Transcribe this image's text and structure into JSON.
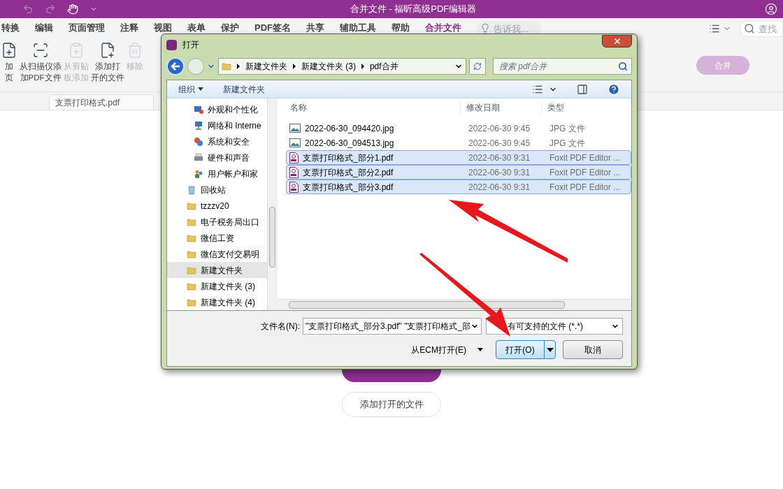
{
  "window": {
    "title": "合并文件 - 福昕高级PDF编辑器"
  },
  "menu": [
    {
      "label": "转换",
      "selected": false
    },
    {
      "label": "编辑",
      "selected": false
    },
    {
      "label": "页面管理",
      "selected": false
    },
    {
      "label": "注释",
      "selected": false
    },
    {
      "label": "视图",
      "selected": false
    },
    {
      "label": "表单",
      "selected": false
    },
    {
      "label": "保护",
      "selected": false
    },
    {
      "label": "PDF签名",
      "selected": false
    },
    {
      "label": "共享",
      "selected": false
    },
    {
      "label": "辅助工具",
      "selected": false
    },
    {
      "label": "帮助",
      "selected": false
    },
    {
      "label": "合并文件",
      "selected": true
    }
  ],
  "tell_me": {
    "placeholder": "告诉我..."
  },
  "find": {
    "placeholder": "查找"
  },
  "toolbar": [
    {
      "kind": "add",
      "lines": [
        "加",
        "页"
      ],
      "disabled": false
    },
    {
      "kind": "scan",
      "lines": [
        "从扫描仪添",
        "加PDF文件"
      ],
      "disabled": false
    },
    {
      "kind": "clipboard",
      "lines": [
        "从剪贴",
        "板添加"
      ],
      "disabled": true
    },
    {
      "kind": "open",
      "lines": [
        "添加打",
        "开的文件"
      ],
      "disabled": false
    },
    {
      "kind": "remove",
      "lines": [
        "移除"
      ],
      "disabled": true
    }
  ],
  "merge_button": {
    "label": "合并",
    "disabled": true
  },
  "document_tab": {
    "label": "支票打印格式.pdf"
  },
  "content_buttons": [
    {
      "kind": "primary"
    },
    {
      "label": "添加打开的文件",
      "kind": "outline"
    }
  ],
  "dialog": {
    "title": "打开",
    "breadcrumb": [
      "新建文件夹",
      "新建文件夹 (3)",
      "pdf合并"
    ],
    "search": {
      "placeholder": "搜索 pdf合并"
    },
    "toolbar": [
      "组织",
      "新建文件夹"
    ],
    "nav": [
      {
        "label": "外观和个性化",
        "kind": "appearance",
        "selected": false
      },
      {
        "label": "网络和 Interne",
        "kind": "network",
        "selected": false
      },
      {
        "label": "系统和安全",
        "kind": "security",
        "selected": false
      },
      {
        "label": "硬件和声音",
        "kind": "hardware",
        "selected": false
      },
      {
        "label": "用户帐户和家",
        "kind": "users",
        "selected": false
      },
      {
        "label": "回收站",
        "kind": "recycle",
        "selected": false
      },
      {
        "label": "tzzzv20",
        "kind": "folder",
        "selected": false
      },
      {
        "label": "电子税务局出口",
        "kind": "folder",
        "selected": false
      },
      {
        "label": "微信工资",
        "kind": "folder",
        "selected": false
      },
      {
        "label": "微信支付交易明",
        "kind": "folder",
        "selected": false
      },
      {
        "label": "新建文件夹",
        "kind": "folder",
        "selected": true
      },
      {
        "label": "新建文件夹 (3)",
        "kind": "folder",
        "selected": false
      },
      {
        "label": "新建文件夹 (4)",
        "kind": "folder",
        "selected": false
      }
    ],
    "columns": [
      "名称",
      "修改日期",
      "类型"
    ],
    "files": [
      {
        "name": "2022-06-30_094420.jpg",
        "date": "2022-06-30 9:45",
        "type": "JPG 文件",
        "kind": "image",
        "selected": false
      },
      {
        "name": "2022-06-30_094513.jpg",
        "date": "2022-06-30 9:45",
        "type": "JPG 文件",
        "kind": "image",
        "selected": false
      },
      {
        "name": "支票打印格式_部分1.pdf",
        "date": "2022-06-30 9:31",
        "type": "Foxit PDF Editor ...",
        "kind": "pdf",
        "selected": true
      },
      {
        "name": "支票打印格式_部分2.pdf",
        "date": "2022-06-30 9:31",
        "type": "Foxit PDF Editor ...",
        "kind": "pdf",
        "selected": true
      },
      {
        "name": "支票打印格式_部分3.pdf",
        "date": "2022-06-30 9:31",
        "type": "Foxit PDF Editor ...",
        "kind": "pdf",
        "selected": true
      }
    ],
    "filename_label": "文件名(N):",
    "filename": "\"支票打印格式_部分3.pdf\" \"支票打印格式_部",
    "filter": "有可支持的文件 (*.*)",
    "ecm": "从ECM打开(E)",
    "open_button": "打开(O)",
    "cancel_button": "取消"
  }
}
